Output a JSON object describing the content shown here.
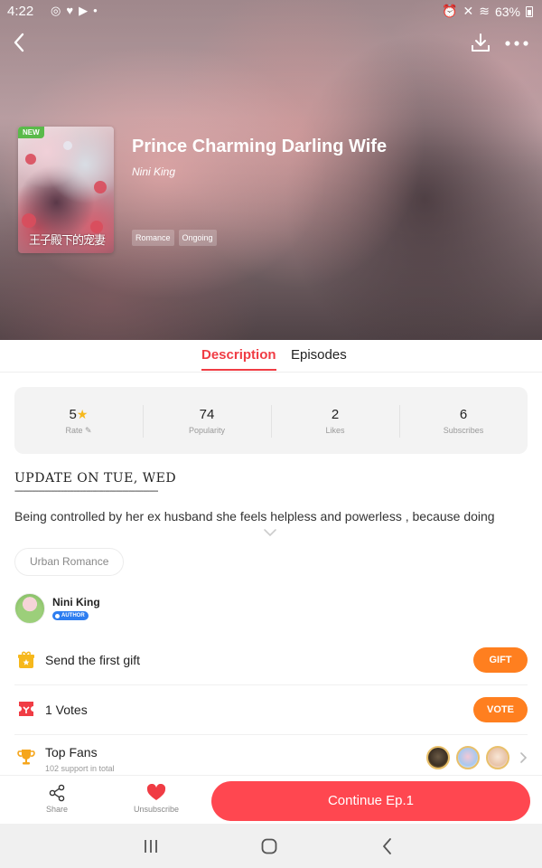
{
  "status_bar": {
    "time": "4:22",
    "battery": "63%"
  },
  "comic": {
    "title": "Prince Charming Darling Wife",
    "author": "Nini King",
    "new_badge": "NEW",
    "tags": [
      "Romance",
      "Ongoing"
    ]
  },
  "tabs": [
    {
      "label": "Description",
      "active": true
    },
    {
      "label": "Episodes",
      "active": false
    }
  ],
  "stats": [
    {
      "value": "5",
      "label": "Rate"
    },
    {
      "value": "74",
      "label": "Popularity"
    },
    {
      "value": "2",
      "label": "Likes"
    },
    {
      "value": "6",
      "label": "Subscribes"
    }
  ],
  "description": {
    "update_line": "UPDATE ON TUE, WED",
    "divider": "--------------------------------------------------------------------",
    "text": "Being controlled by her ex husband she feels helpless and powerless , because doing"
  },
  "genre": "Urban Romance",
  "author_row": {
    "name": "Nini King",
    "badge": "AUTHOR"
  },
  "gift_row": {
    "label": "Send the first gift",
    "button": "GIFT"
  },
  "votes_row": {
    "label": "1 Votes",
    "button": "VOTE"
  },
  "fans_row": {
    "label": "Top Fans",
    "sub": "102 support in total"
  },
  "bottom_bar": {
    "share": "Share",
    "unsubscribe": "Unsubscribe",
    "continue": "Continue Ep.1"
  },
  "colors": {
    "accent_red": "#f03c44",
    "button_orange": "#ff7f1f",
    "continue_red": "#ff4750",
    "star_yellow": "#f6b81c"
  }
}
